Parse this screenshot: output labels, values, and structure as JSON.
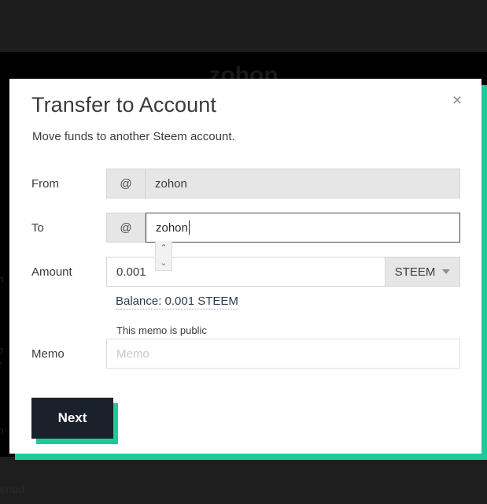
{
  "background": {
    "watermark_name": "zohon",
    "ghost_fragments": [
      "m",
      "t",
      "lo",
      "or",
      "m"
    ],
    "footer_fragment": "period"
  },
  "modal": {
    "title": "Transfer to Account",
    "subtitle": "Move funds to another Steem account.",
    "close_label": "×",
    "accent_color": "#1ec99a",
    "fields": {
      "from": {
        "label": "From",
        "prefix": "@",
        "value": "zohon"
      },
      "to": {
        "label": "To",
        "prefix": "@",
        "value": "zohon"
      },
      "amount": {
        "label": "Amount",
        "value": "0.001",
        "spinner_up": "⌃",
        "spinner_down": "⌄",
        "currency": "STEEM"
      },
      "memo": {
        "label": "Memo",
        "note": "This memo is public",
        "placeholder": "Memo",
        "value": ""
      }
    },
    "balance_link": "Balance: 0.001 STEEM",
    "submit_label": "Next"
  }
}
